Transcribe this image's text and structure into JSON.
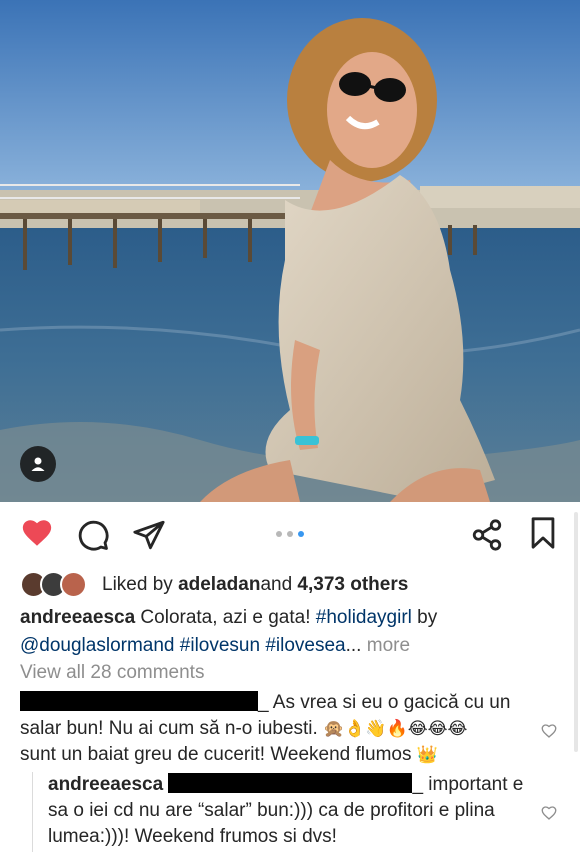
{
  "post": {
    "image_alt_icons": [
      "user-tag-icon"
    ],
    "likes_prefix": "Liked by ",
    "likes_user": "adeladan",
    "likes_middle": " and ",
    "likes_count": "4,373 others",
    "caption_user": "andreeaesca",
    "caption_text": " Colorata, azi e gata! ",
    "caption_tag1": "#holidaygirl",
    "caption_by": " by",
    "caption_tag2": "@douglaslormand",
    "caption_tag3": " #ilovesun",
    "caption_tag4": " #ilovesea",
    "caption_ellipsis": "...",
    "more_label": " more",
    "view_all_comments": "View all 28 comments"
  },
  "comments": [
    {
      "text_start": "_ As vrea si eu o gacică cu un salar bun! Nu ai cum să n-o iubesti. ",
      "emojis": "🙊👌👋🔥😂😂😂",
      "text_end": "sunt un baiat greu de cucerit! Weekend flumos ",
      "end_emoji": "👑"
    },
    {
      "user": "andreeaesca",
      "text_after_redact": "_ important e sa o iei cd nu are “salar” bun:))) ca de profitori e plina lumea:)))! Weekend frumos si dvs!"
    }
  ],
  "colors": {
    "like_red": "#ed4956",
    "link_blue": "#003569",
    "muted": "#8e8e8e",
    "dot_active": "#3897f0"
  },
  "icons": [
    "heart-filled-icon",
    "comment-icon",
    "share-icon",
    "share-nodes-icon",
    "bookmark-icon",
    "heart-outline-icon"
  ],
  "carousel": {
    "count": 3,
    "active_index": 2
  }
}
